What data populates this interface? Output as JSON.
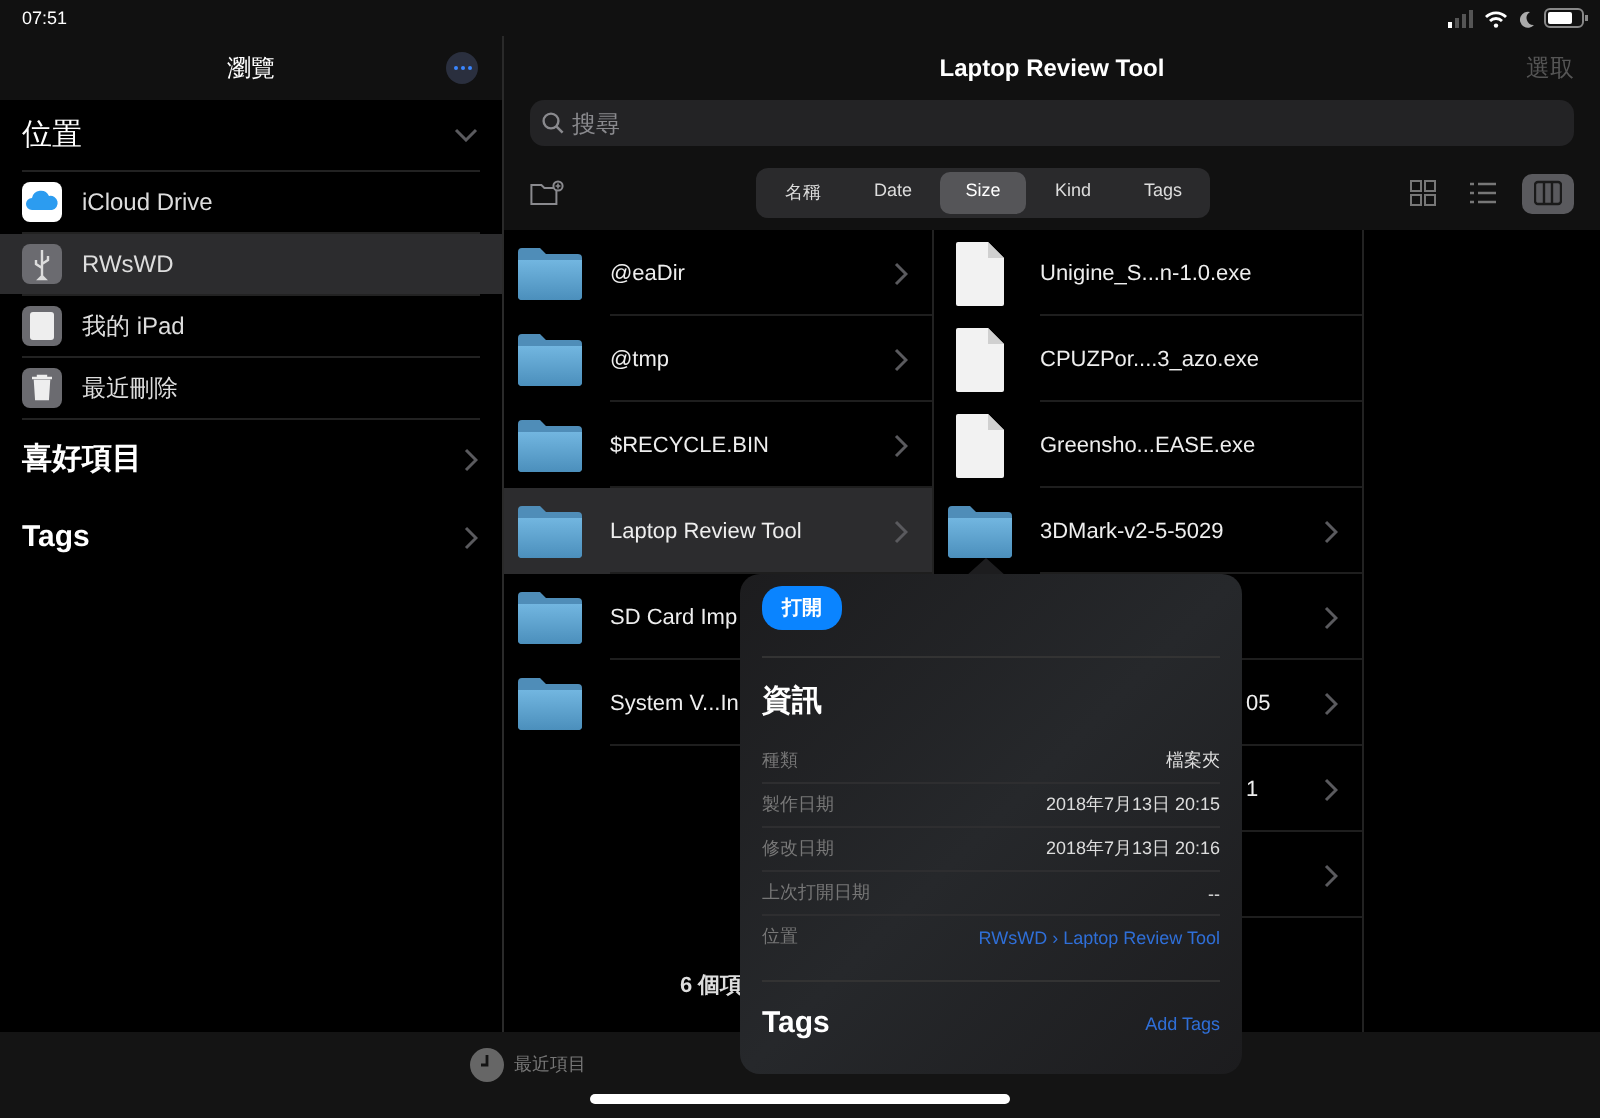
{
  "status_bar": {
    "time": "07:51"
  },
  "sidebar": {
    "title": "瀏覽",
    "sections": [
      {
        "title": "位置",
        "expanded": true,
        "items": [
          {
            "label": "iCloud Drive",
            "kind": "cloud",
            "selected": false
          },
          {
            "label": "RWsWD",
            "kind": "usb",
            "selected": true
          },
          {
            "label": "我的 iPad",
            "kind": "ipad",
            "selected": false
          },
          {
            "label": "最近刪除",
            "kind": "trash",
            "selected": false
          }
        ]
      },
      {
        "title": "喜好項目",
        "expanded": false
      },
      {
        "title": "Tags",
        "expanded": false
      }
    ]
  },
  "main": {
    "title": "Laptop Review Tool",
    "action": "選取",
    "search": {
      "placeholder": "搜尋"
    },
    "sort_tabs": [
      {
        "label": "名稱",
        "selected": false
      },
      {
        "label": "Date",
        "selected": false
      },
      {
        "label": "Size",
        "selected": true
      },
      {
        "label": "Kind",
        "selected": false
      },
      {
        "label": "Tags",
        "selected": false
      }
    ],
    "view_modes": [
      {
        "kind": "grid",
        "selected": false
      },
      {
        "kind": "list",
        "selected": false
      },
      {
        "kind": "columns",
        "selected": true
      }
    ],
    "columns": [
      {
        "rows": [
          {
            "name": "@eaDir",
            "kind": "folder",
            "selected": false
          },
          {
            "name": "@tmp",
            "kind": "folder",
            "selected": false
          },
          {
            "name": "$RECYCLE.BIN",
            "kind": "folder",
            "selected": false
          },
          {
            "name": "Laptop Review Tool",
            "kind": "folder",
            "selected": true
          },
          {
            "name": "SD Card Imp",
            "kind": "folder",
            "selected": false
          },
          {
            "name": "System V...In",
            "kind": "folder",
            "selected": false
          }
        ]
      },
      {
        "rows": [
          {
            "name": "Unigine_S...n-1.0.exe",
            "kind": "file",
            "selected": false
          },
          {
            "name": "CPUZPor....3_azo.exe",
            "kind": "file",
            "selected": false
          },
          {
            "name": "Greensho...EASE.exe",
            "kind": "file",
            "selected": false
          },
          {
            "name": "3DMark-v2-5-5029",
            "kind": "folder",
            "selected": false
          },
          {
            "kind": "covered",
            "selected": false
          },
          {
            "name": "05",
            "kind": "covered",
            "selected": false
          },
          {
            "name": "1",
            "kind": "covered",
            "selected": false
          },
          {
            "kind": "covered",
            "selected": false
          }
        ]
      }
    ],
    "item_count": "6 個項"
  },
  "popover": {
    "open_button": "打開",
    "info_title": "資訊",
    "info": [
      {
        "label": "種類",
        "value": "檔案夾",
        "kind": "text"
      },
      {
        "label": "製作日期",
        "value": "2018年7月13日 20:15",
        "kind": "text"
      },
      {
        "label": "修改日期",
        "value": "2018年7月13日 20:16",
        "kind": "text"
      },
      {
        "label": "上次打開日期",
        "value": "--",
        "kind": "text"
      },
      {
        "label": "位置",
        "value": "RWsWD › Laptop Review Tool",
        "kind": "link"
      }
    ],
    "tags_title": "Tags",
    "add_tags": "Add Tags"
  },
  "tab_bar": [
    {
      "label": "最近項目",
      "kind": "clock",
      "selected": false
    }
  ]
}
